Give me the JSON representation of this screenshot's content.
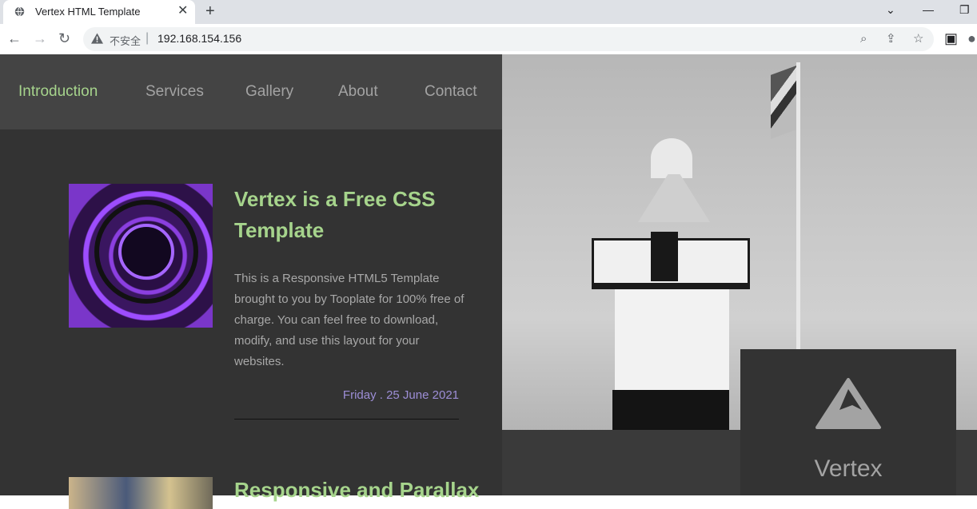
{
  "browser": {
    "tab_title": "Vertex HTML Template",
    "insecure_label": "不安全",
    "url": "192.168.154.156"
  },
  "nav": {
    "items": [
      "Introduction",
      "Services",
      "Gallery",
      "About",
      "Contact"
    ],
    "active": "Introduction"
  },
  "article1": {
    "title": "Vertex is a Free CSS Template",
    "description": "This is a Responsive HTML5 Template brought to you by Tooplate for 100% free of charge. You can feel free to download, modify, and use this layout for your websites.",
    "date": "Friday . 25 June 2021"
  },
  "article2": {
    "title": "Responsive and Parallax"
  },
  "brand": {
    "name": "Vertex"
  },
  "colors": {
    "accent_green": "#a6d48c",
    "date_purple": "#9d8ed6",
    "panel_dark": "#333333",
    "nav_bg": "#444444"
  }
}
